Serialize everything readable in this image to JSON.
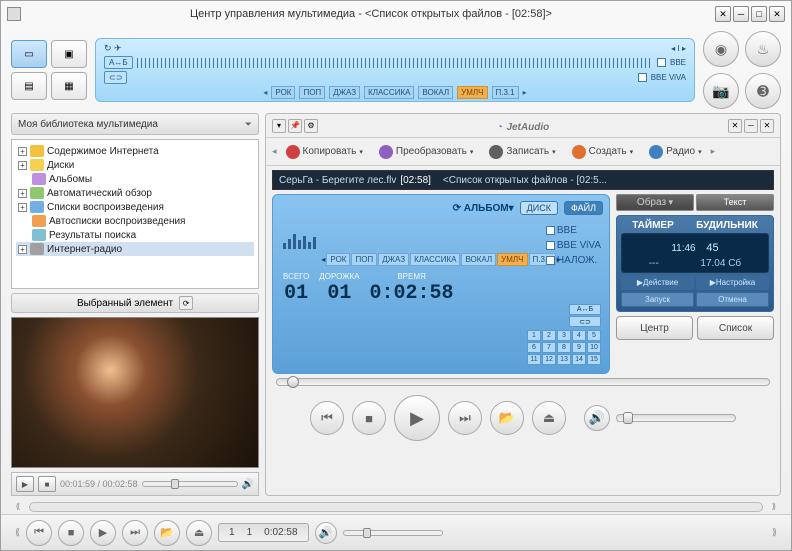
{
  "window": {
    "title": "Центр управления мультимедиа - <Список открытых файлов - [02:58]>"
  },
  "eq_top": {
    "tags": [
      "А↔Б"
    ],
    "genres": [
      "РОК",
      "ПОП",
      "ДЖАЗ",
      "КЛАССИКА",
      "ВОКАЛ",
      "УМЛЧ",
      "П.3.1"
    ],
    "checks": [
      "ВВЕ",
      "ВВЕ ViVA"
    ]
  },
  "library": {
    "header": "Моя библиотека мультимедиа",
    "items": [
      "Содержимое Интернета",
      "Диски",
      "Альбомы",
      "Автоматический обзор",
      "Списки воспроизведения",
      "Автосписки воспроизведения",
      "Результаты поиска",
      "Интернет-радио"
    ]
  },
  "selected": {
    "header": "Выбранный элемент"
  },
  "preview": {
    "time": "00:01:59 / 00:02:58"
  },
  "logo": "JetAudio",
  "toolbar": {
    "copy": "Копировать",
    "convert": "Преобразовать",
    "record": "Записать",
    "create": "Создать",
    "radio": "Радио"
  },
  "track": {
    "name": "СерьГа - Берегите лес.flv",
    "time": "[02:58]",
    "list": "<Список открытых файлов - [02:5..."
  },
  "display": {
    "album": "АЛЬБОМ",
    "disk": "ДИСК",
    "file": "ФАЙЛ",
    "checks": [
      "ВВЕ",
      "ВВЕ ViVA",
      "НАЛОЖ."
    ],
    "genres": [
      "РОК",
      "ПОП",
      "ДЖАЗ",
      "КЛАССИКА",
      "ВОКАЛ",
      "УМЛЧ",
      "П.3.1"
    ],
    "total_lbl": "ВСЕГО",
    "total_val": "01",
    "track_lbl": "ДОРОЖКА",
    "track_val": "01",
    "time_lbl": "ВРЕМЯ",
    "time_val": "0:02:58",
    "ab1": "А↔Б",
    "ab2": "⊂⊃",
    "nums": [
      "1",
      "2",
      "3",
      "4",
      "5",
      "6",
      "7",
      "8",
      "9",
      "10",
      "11",
      "12",
      "13",
      "14",
      "15"
    ]
  },
  "right": {
    "tab_image": "Образ",
    "tab_text": "Текст",
    "timer": "ТАЙМЕР",
    "alarm": "БУДИЛЬНИК",
    "clock": "11:46",
    "seconds": "45",
    "date_l": "---",
    "date_r": "17.04 Сб",
    "action": "▶Действие",
    "settings": "▶Настройка",
    "start": "Запуск",
    "cancel": "Отмена",
    "center": "Центр",
    "list": "Список"
  },
  "footer": {
    "track": "1",
    "total": "1",
    "time": "0:02:58"
  }
}
